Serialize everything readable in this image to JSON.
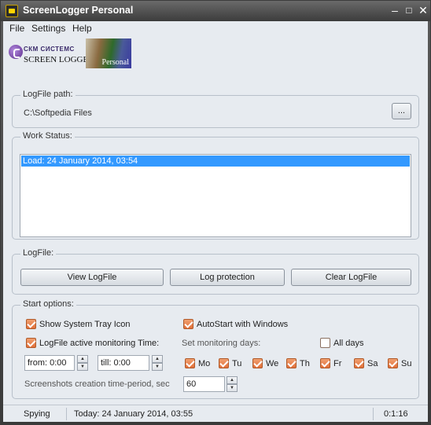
{
  "window": {
    "title": "ScreenLogger Personal"
  },
  "menu": {
    "items": [
      "File",
      "Settings",
      "Help"
    ]
  },
  "logo": {
    "company": "СКМ СИСТЕМС",
    "product": "SCREEN LOGGER",
    "edition": "Personal"
  },
  "logfile_path": {
    "group_label": "LogFile path:",
    "value": "C:\\Softpedia Files",
    "browse_label": "..."
  },
  "work_status": {
    "group_label": "Work Status:",
    "entries": [
      "Load: 24 January 2014, 03:54"
    ]
  },
  "logfile": {
    "group_label": "LogFile:",
    "view_label": "View LogFile",
    "protection_label": "Log protection",
    "clear_label": "Clear LogFile"
  },
  "start_options": {
    "group_label": "Start options:",
    "show_tray": {
      "label": "Show System Tray Icon",
      "checked": true
    },
    "autostart": {
      "label": "AutoStart with Windows",
      "checked": true
    },
    "active_monitoring": {
      "label": "LogFile active monitoring Time:",
      "checked": true
    },
    "monitoring_days_label": "Set monitoring days:",
    "all_days": {
      "label": "All days",
      "checked": false
    },
    "from": "from: 0:00",
    "till": "till: 0:00",
    "days": [
      {
        "label": "Mo",
        "checked": true
      },
      {
        "label": "Tu",
        "checked": true
      },
      {
        "label": "We",
        "checked": true
      },
      {
        "label": "Th",
        "checked": true
      },
      {
        "label": "Fr",
        "checked": true
      },
      {
        "label": "Sa",
        "checked": true
      },
      {
        "label": "Su",
        "checked": true
      }
    ],
    "period_label": "Screenshots creation time-period, sec",
    "period_value": "60"
  },
  "status": {
    "state": "Spying",
    "today": "Today: 24 January 2014, 03:55",
    "elapsed": "0:1:16"
  },
  "colors": {
    "accent": "#3399ff",
    "check": "#e2703a",
    "titlebar": "#4a4a4a"
  }
}
